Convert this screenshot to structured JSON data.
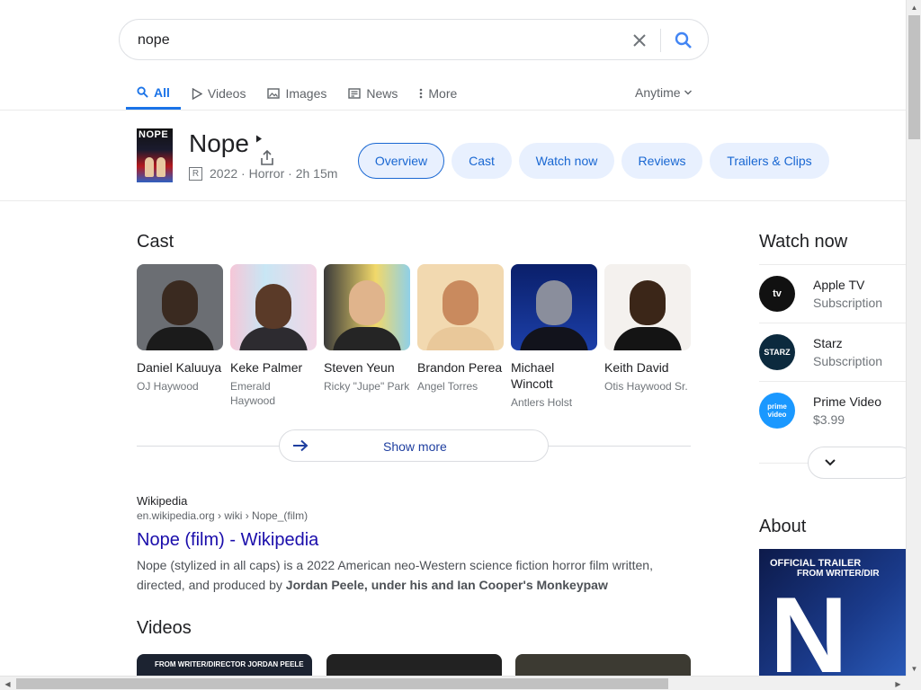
{
  "search": {
    "query": "nope"
  },
  "tabs": [
    {
      "label": "All",
      "icon": "search-icon",
      "active": true
    },
    {
      "label": "Videos",
      "icon": "play-icon"
    },
    {
      "label": "Images",
      "icon": "image-icon"
    },
    {
      "label": "News",
      "icon": "news-icon"
    },
    {
      "label": "More",
      "icon": "more-dots-icon"
    }
  ],
  "anytime": "Anytime",
  "movie": {
    "poster_text": "NOPE",
    "title": "Nope",
    "rating": "R",
    "meta": "2022 · Horror · 2h 15m"
  },
  "chips": [
    "Overview",
    "Cast",
    "Watch now",
    "Reviews",
    "Trailers & Clips"
  ],
  "cast": {
    "title": "Cast",
    "members": [
      {
        "name": "Daniel Kaluuya",
        "role": "OJ Haywood"
      },
      {
        "name": "Keke Palmer",
        "role": "Emerald Haywood"
      },
      {
        "name": "Steven Yeun",
        "role": "Ricky \"Jupe\" Park"
      },
      {
        "name": "Brandon Perea",
        "role": "Angel Torres"
      },
      {
        "name": "Michael Wincott",
        "role": "Antlers Holst"
      },
      {
        "name": "Keith David",
        "role": "Otis Haywood Sr."
      }
    ],
    "show_more": "Show more"
  },
  "wiki": {
    "source": "Wikipedia",
    "url": "en.wikipedia.org › wiki › Nope_(film)",
    "title": "Nope (film) - Wikipedia",
    "snippet_plain": "Nope (stylized in all caps) is a 2022 American neo-Western science fiction horror film written, directed, and produced by ",
    "snippet_bold": "Jordan Peele, under his and Ian Cooper's Monkeypaw"
  },
  "videos": {
    "title": "Videos",
    "thumb1_text": "FROM WRITER/DIRECTOR JORDAN PEELE"
  },
  "watch_now": {
    "title": "Watch now",
    "items": [
      {
        "name": "Apple TV",
        "sub": "Subscription",
        "logo": "tv"
      },
      {
        "name": "Starz",
        "sub": "Subscription",
        "logo": "STARZ"
      },
      {
        "name": "Prime Video",
        "sub": "$3.99",
        "logo": "prime video"
      }
    ]
  },
  "about": {
    "title": "About",
    "tag1": "OFFICIAL TRAILER",
    "tag2": "FROM WRITER/DIR",
    "big_letter": "N"
  },
  "colors": {
    "link": "#1a0dab",
    "accent": "#1a73e8",
    "chip_bg": "#e8f0fe"
  }
}
